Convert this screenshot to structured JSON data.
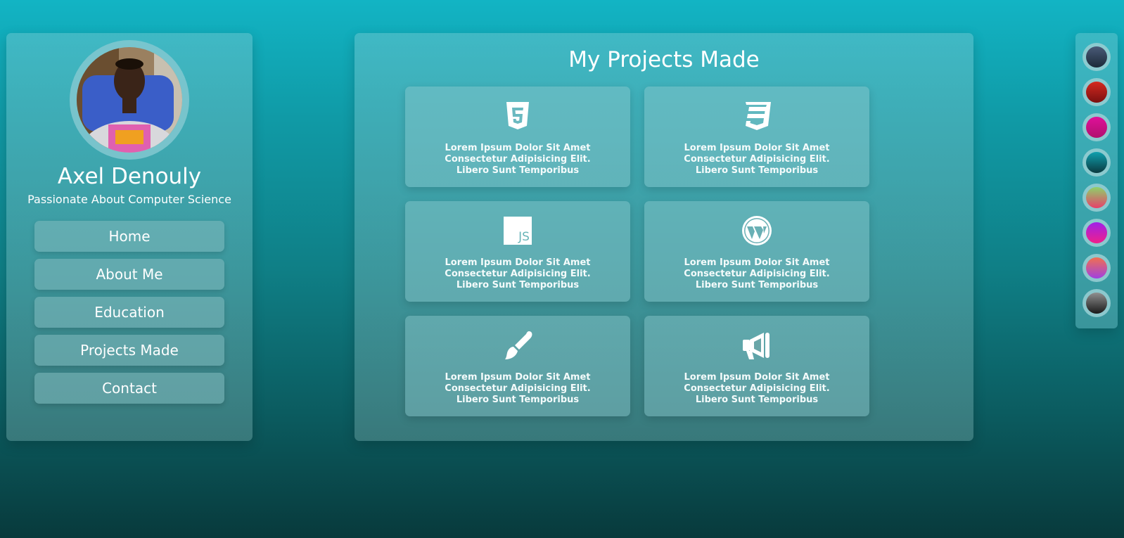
{
  "profile": {
    "name": "Axel Denouly",
    "tagline": "Passionate About Computer Science"
  },
  "nav": {
    "items": [
      {
        "label": "Home"
      },
      {
        "label": "About Me"
      },
      {
        "label": "Education"
      },
      {
        "label": "Projects Made"
      },
      {
        "label": "Contact"
      }
    ]
  },
  "main": {
    "title": "My Projects Made",
    "projects": [
      {
        "icon": "html5-icon",
        "line1": "Lorem Ipsum Dolor Sit Amet",
        "line2": "Consectetur Adipisicing Elit.",
        "line3": "Libero Sunt Temporibus"
      },
      {
        "icon": "css3-icon",
        "line1": "Lorem Ipsum Dolor Sit Amet",
        "line2": "Consectetur Adipisicing Elit.",
        "line3": "Libero Sunt Temporibus"
      },
      {
        "icon": "javascript-icon",
        "line1": "Lorem Ipsum Dolor Sit Amet",
        "line2": "Consectetur Adipisicing Elit.",
        "line3": "Libero Sunt Temporibus"
      },
      {
        "icon": "wordpress-icon",
        "line1": "Lorem Ipsum Dolor Sit Amet",
        "line2": "Consectetur Adipisicing Elit.",
        "line3": "Libero Sunt Temporibus"
      },
      {
        "icon": "paintbrush-icon",
        "line1": "Lorem Ipsum Dolor Sit Amet",
        "line2": "Consectetur Adipisicing Elit.",
        "line3": "Libero Sunt Temporibus"
      },
      {
        "icon": "megaphone-icon",
        "line1": "Lorem Ipsum Dolor Sit Amet",
        "line2": "Consectetur Adipisicing Elit.",
        "line3": "Libero Sunt Temporibus"
      }
    ]
  },
  "theme_swatches": [
    {
      "from": "#4a5a78",
      "to": "#1c2a38"
    },
    {
      "from": "#d42a20",
      "to": "#7a1010"
    },
    {
      "from": "#e0109a",
      "to": "#b0106e"
    },
    {
      "from": "#10a0ae",
      "to": "#0a3a40"
    },
    {
      "from": "#8ed26a",
      "to": "#e8406a"
    },
    {
      "from": "#a020e8",
      "to": "#f0208a"
    },
    {
      "from": "#f07050",
      "to": "#a040e0"
    },
    {
      "from": "#909090",
      "to": "#1a1a1a"
    }
  ],
  "colors": {
    "background_top": "#12b4c4",
    "background_bottom": "#083a3c",
    "text": "#ffffff"
  }
}
